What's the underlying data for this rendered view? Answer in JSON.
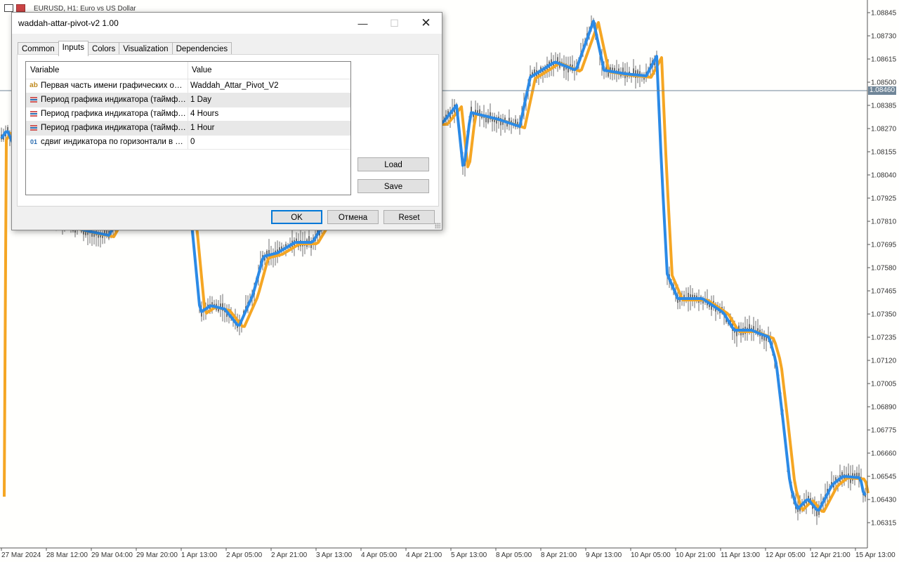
{
  "chart": {
    "title": "EURUSD, H1:  Euro vs US Dollar",
    "current_price": "1.08460",
    "colors": {
      "background": "#fffffd",
      "candles": "#6e6e6e",
      "line_fast": "#2b8ae6",
      "line_slow": "#f5a623",
      "price_line": "#6f8597"
    },
    "price_labels": [
      "1.08845",
      "1.08730",
      "1.08615",
      "1.08500",
      "1.08385",
      "1.08270",
      "1.08155",
      "1.08040",
      "1.07925",
      "1.07810",
      "1.07695",
      "1.07580",
      "1.07465",
      "1.07350",
      "1.07235",
      "1.07120",
      "1.07005",
      "1.06890",
      "1.06775",
      "1.06660",
      "1.06545",
      "1.06430",
      "1.06315"
    ],
    "time_labels": [
      "27 Mar 2024",
      "28 Mar 12:00",
      "29 Mar 04:00",
      "29 Mar 20:00",
      "1 Apr 13:00",
      "2 Apr 05:00",
      "2 Apr 21:00",
      "3 Apr 13:00",
      "4 Apr 05:00",
      "4 Apr 21:00",
      "5 Apr 13:00",
      "8 Apr 05:00",
      "8 Apr 21:00",
      "9 Apr 13:00",
      "10 Apr 05:00",
      "10 Apr 21:00",
      "11 Apr 13:00",
      "12 Apr 05:00",
      "12 Apr 21:00",
      "15 Apr 13:00"
    ]
  },
  "dialog": {
    "title": "waddah-attar-pivot-v2 1.00",
    "tabs": [
      "Common",
      "Inputs",
      "Colors",
      "Visualization",
      "Dependencies"
    ],
    "active_tab": "Inputs",
    "grid": {
      "headers": {
        "variable": "Variable",
        "value": "Value"
      },
      "rows": [
        {
          "icon": "ab",
          "type": "string",
          "name": "Первая часть имени графических объ...",
          "value": "Waddah_Attar_Pivot_V2"
        },
        {
          "icon": "enum-icon",
          "type": "enum",
          "name": "Период графика индикатора (таймфр...",
          "value": "1 Day"
        },
        {
          "icon": "enum-icon",
          "type": "enum",
          "name": "Период графика индикатора (таймфр...",
          "value": "4 Hours"
        },
        {
          "icon": "enum-icon",
          "type": "enum",
          "name": "Период графика индикатора (таймфр...",
          "value": "1 Hour"
        },
        {
          "icon": "01",
          "type": "int",
          "name": "сдвиг индикатора по горизонтали в б...",
          "value": "0"
        }
      ]
    },
    "buttons": {
      "load": "Load",
      "save": "Save",
      "ok": "OK",
      "cancel": "Отмена",
      "reset": "Reset"
    }
  }
}
